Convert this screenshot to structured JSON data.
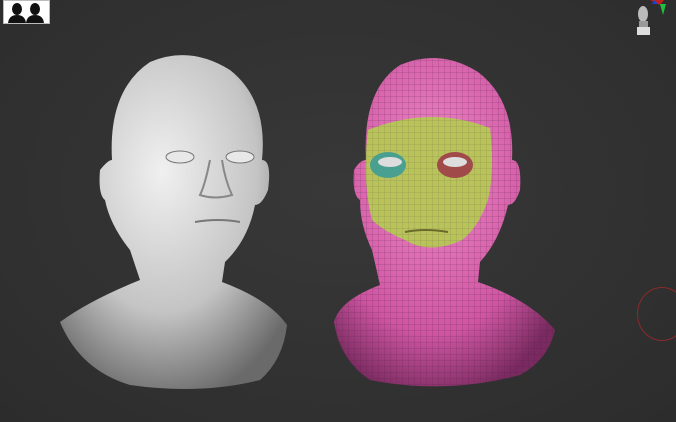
{
  "viewport": {
    "background_color": "#323232",
    "top_left_icon": "two-person-silhouettes-icon",
    "top_right_icon": "navigation-head-gizmo-icon",
    "rotate_gizmo_icon": "rotate-circle-icon",
    "models": [
      {
        "name": "sculpted-head",
        "color": "#c8c8c8"
      },
      {
        "name": "polygroup-head",
        "colors": [
          "#d65ca8",
          "#b9c45a",
          "#4aa090",
          "#a04a4a"
        ]
      }
    ]
  }
}
